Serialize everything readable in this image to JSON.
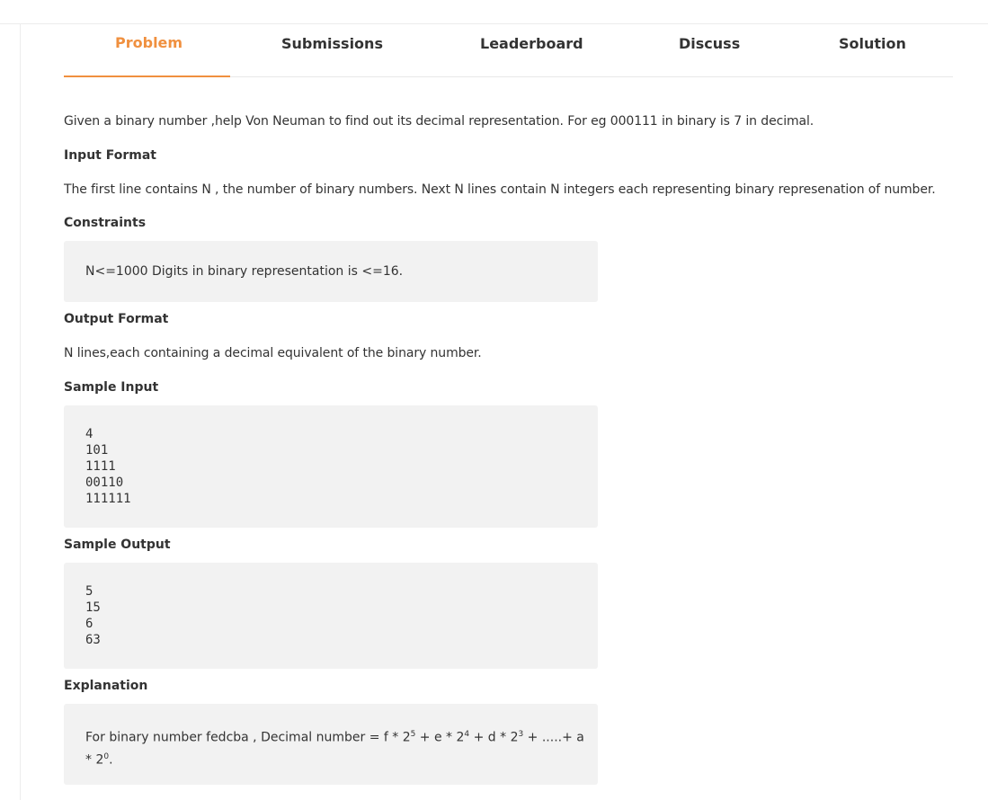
{
  "tabs": [
    {
      "label": "Problem",
      "active": true
    },
    {
      "label": "Submissions",
      "active": false
    },
    {
      "label": "Leaderboard",
      "active": false
    },
    {
      "label": "Discuss",
      "active": false
    },
    {
      "label": "Solution",
      "active": false
    }
  ],
  "colors": {
    "accent": "#f0903f",
    "box_bg": "#f2f2f2",
    "text": "#333333"
  },
  "problem": {
    "statement": "Given a binary number ,help Von Neuman to find out its decimal representation. For eg 000111 in binary is 7 in decimal.",
    "input_format_heading": "Input Format",
    "input_format": "The first line contains N , the number of binary numbers. Next N lines contain N integers each representing binary represenation of number.",
    "constraints_heading": "Constraints",
    "constraints": "N<=1000 Digits in binary representation is <=16.",
    "output_format_heading": "Output Format",
    "output_format": "N lines,each containing a decimal equivalent of the binary number.",
    "sample_input_heading": "Sample Input",
    "sample_input": [
      "4",
      "101",
      "1111",
      "00110",
      "111111"
    ],
    "sample_output_heading": "Sample Output",
    "sample_output": [
      "5",
      "15",
      "6",
      "63"
    ],
    "explanation_heading": "Explanation",
    "explanation": {
      "prefix": "For binary number fedcba , Decimal number = f * 2",
      "exp1": "5",
      "mid1": " + e * 2",
      "exp2": "4",
      "mid2": " + d * 2",
      "exp3": "3",
      "mid3": " + .....+ a",
      "line2_prefix": "* 2",
      "exp4": "0",
      "line2_suffix": "."
    }
  }
}
